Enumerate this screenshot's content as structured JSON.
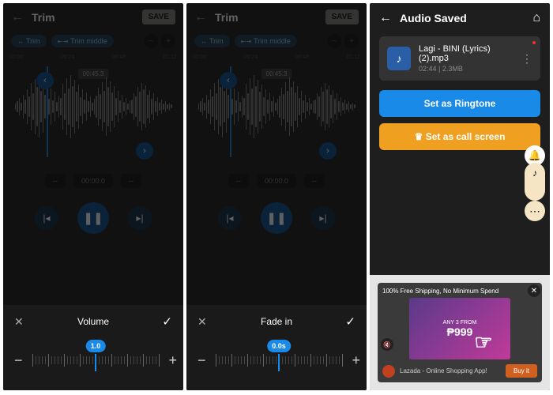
{
  "screen1": {
    "title": "Trim",
    "save": "SAVE",
    "chip1": "Trim",
    "chip2": "Trim middle",
    "ruler": [
      "00:00",
      "00:24",
      "00:48",
      "01:12"
    ],
    "duration_badge": "00:45.3",
    "time1": "--",
    "time2": "00:00.0",
    "time3": "--",
    "sheet_title": "Volume",
    "slider_value": "1.0"
  },
  "screen2": {
    "title": "Trim",
    "save": "SAVE",
    "chip1": "Trim",
    "chip2": "Trim middle",
    "ruler": [
      "00:00",
      "00:24",
      "00:48",
      "01:12"
    ],
    "duration_badge": "00:45.3",
    "time1": "--",
    "time2": "00:00.0",
    "time3": "--",
    "sheet_title": "Fade in",
    "slider_value": "0.0s"
  },
  "screen3": {
    "title": "Audio Saved",
    "audio_name": "Lagi - BINI (Lyrics)(2).mp3",
    "audio_meta": "02:44 | 2.3MB",
    "btn_ringtone": "Set as Ringtone",
    "btn_callscreen": "Set as call screen",
    "ad_headline": "100% Free Shipping, No Minimum Spend",
    "ad_price": "₱999",
    "ad_pre": "ANY 3 FROM",
    "ad_footer": "Lazada - Online Shopping App!",
    "ad_cta": "Buy it"
  }
}
